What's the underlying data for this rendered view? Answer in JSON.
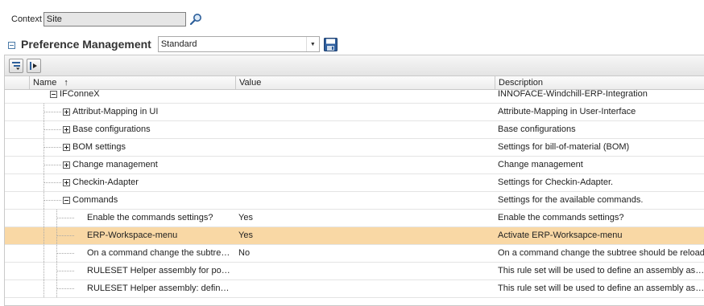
{
  "context": {
    "label": "Context",
    "value": "Site"
  },
  "preference_management": {
    "title": "Preference Management",
    "view_selected": "Standard"
  },
  "columns": {
    "name": "Name",
    "sort_indicator": "↑",
    "value": "Value",
    "description": "Description"
  },
  "rows": [
    {
      "name": "IFConneX",
      "value": "",
      "description": "INNOFACE-Windchill-ERP-Integration",
      "level": 0,
      "expander": "minus",
      "selected": false
    },
    {
      "name": "Attribut-Mapping in UI",
      "value": "",
      "description": "Attribute-Mapping in User-Interface",
      "level": 1,
      "expander": "plus",
      "selected": false
    },
    {
      "name": "Base configurations",
      "value": "",
      "description": "Base configurations",
      "level": 1,
      "expander": "plus",
      "selected": false
    },
    {
      "name": "BOM settings",
      "value": "",
      "description": "Settings for bill-of-material (BOM)",
      "level": 1,
      "expander": "plus",
      "selected": false
    },
    {
      "name": "Change management",
      "value": "",
      "description": "Change management",
      "level": 1,
      "expander": "plus",
      "selected": false
    },
    {
      "name": "Checkin-Adapter",
      "value": "",
      "description": "Settings for Checkin-Adapter.",
      "level": 1,
      "expander": "plus",
      "selected": false
    },
    {
      "name": "Commands",
      "value": "",
      "description": "Settings for the available commands.",
      "level": 1,
      "expander": "minus",
      "selected": false
    },
    {
      "name": "Enable the commands settings?",
      "value": "Yes",
      "description": "Enable the commands settings?",
      "level": 2,
      "expander": "none",
      "selected": false
    },
    {
      "name": "ERP-Workspace-menu",
      "value": "Yes",
      "description": "Activate ERP-Worksapce-menu",
      "level": 2,
      "expander": "none",
      "selected": true
    },
    {
      "name": "On a command change the subtree...",
      "value": "No",
      "description": "On a command change the subtree should be reload",
      "level": 2,
      "expander": "none",
      "selected": false
    },
    {
      "name": "RULESET Helper assembly for pos...",
      "value": "",
      "description": "This rule set will be used to define an assembly as he",
      "level": 2,
      "expander": "none",
      "selected": false
    },
    {
      "name": "RULESET Helper assembly: define...",
      "value": "",
      "description": "This rule set will be used to define an assembly as he",
      "level": 2,
      "expander": "none",
      "selected": false
    }
  ]
}
